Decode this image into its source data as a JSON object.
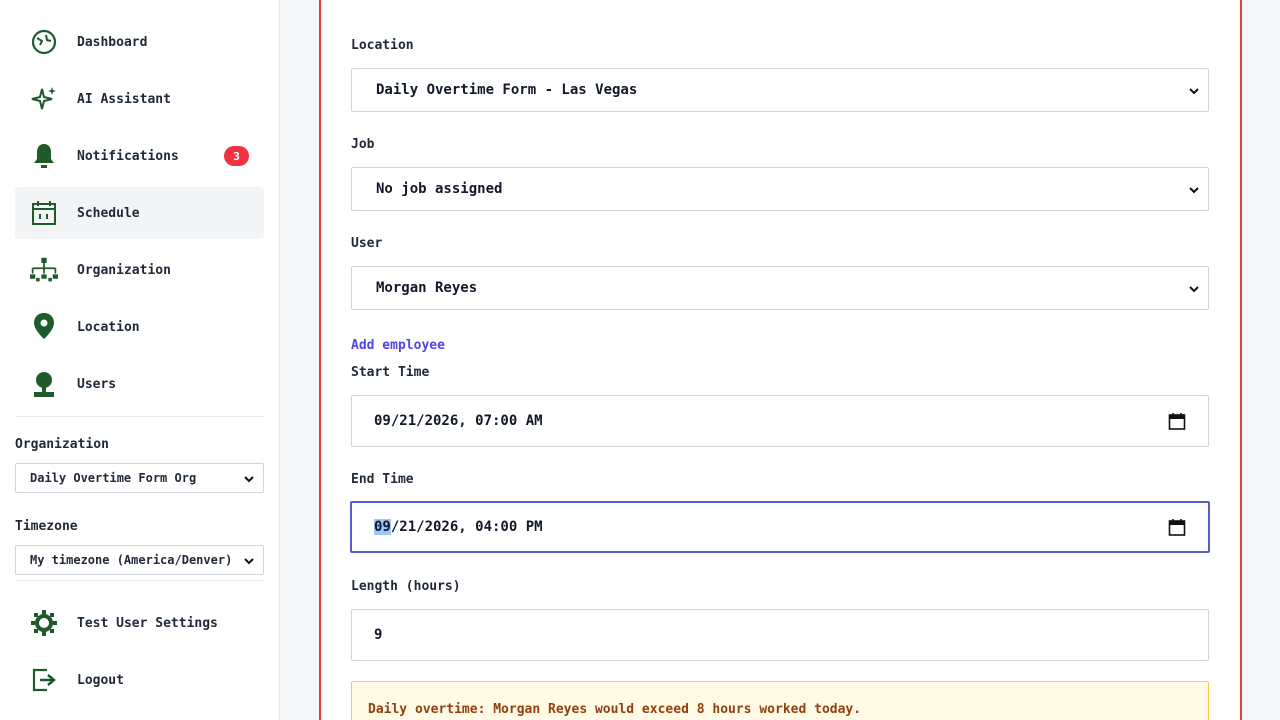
{
  "sidebar": {
    "nav": [
      {
        "label": "Dashboard",
        "icon": "dashboard-icon"
      },
      {
        "label": "AI Assistant",
        "icon": "sparkle-icon"
      },
      {
        "label": "Notifications",
        "icon": "bell-icon",
        "badge": "3"
      },
      {
        "label": "Schedule",
        "icon": "calendar-icon",
        "active": true
      },
      {
        "label": "Organization",
        "icon": "org-chart-icon"
      },
      {
        "label": "Location",
        "icon": "map-pin-icon"
      },
      {
        "label": "Users",
        "icon": "user-icon"
      }
    ],
    "organization_label": "Organization",
    "organization_value": "Daily Overtime Form Org",
    "timezone_label": "Timezone",
    "timezone_value": "My timezone (America/Denver)",
    "settings_label": "Test User Settings",
    "logout_label": "Logout"
  },
  "form": {
    "location_label": "Location",
    "location_value": "Daily Overtime Form - Las Vegas",
    "job_label": "Job",
    "job_value": "No job assigned",
    "user_label": "User",
    "user_value": "Morgan Reyes",
    "add_employee": "Add employee",
    "start_label": "Start Time",
    "start_value": "09/21/2026, 07:00 AM",
    "end_label": "End Time",
    "end_value_month": "09",
    "end_value_rest": "/21/2026, 04:00 PM",
    "length_label": "Length (hours)",
    "length_value": "9",
    "warning": "Daily overtime: Morgan Reyes would exceed 8 hours worked today."
  },
  "colors": {
    "icon_green": "#1f5a2a",
    "panel_border": "#e53e3e",
    "focus_border": "#5b5bd6",
    "link": "#4f46e5",
    "badge": "#ef3340"
  }
}
